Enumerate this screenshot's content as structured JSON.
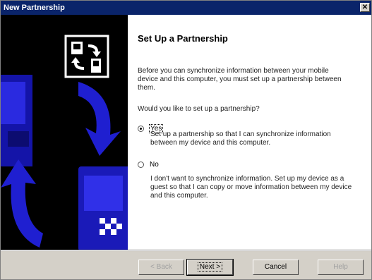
{
  "window": {
    "title": "New Partnership",
    "close_label": "✕"
  },
  "content": {
    "heading": "Set Up a Partnership",
    "intro": "Before you can synchronize information between your mobile device and this computer, you must set up a partnership between them.",
    "question": "Would you like to set up a partnership?",
    "options": [
      {
        "label": "Yes",
        "selected": true,
        "description": "Set up a partnership so that I can synchronize information between my device and this computer."
      },
      {
        "label": "No",
        "selected": false,
        "description": "I don't want to synchronize information. Set up my device as a guest so that I can copy or move information between my device and this computer."
      }
    ]
  },
  "buttons": {
    "back": "< Back",
    "next": "Next >",
    "cancel": "Cancel",
    "help": "Help"
  },
  "colors": {
    "titlebar": "#0a246a",
    "banner_blue": "#1c1cc8",
    "face": "#d4d0c8"
  }
}
